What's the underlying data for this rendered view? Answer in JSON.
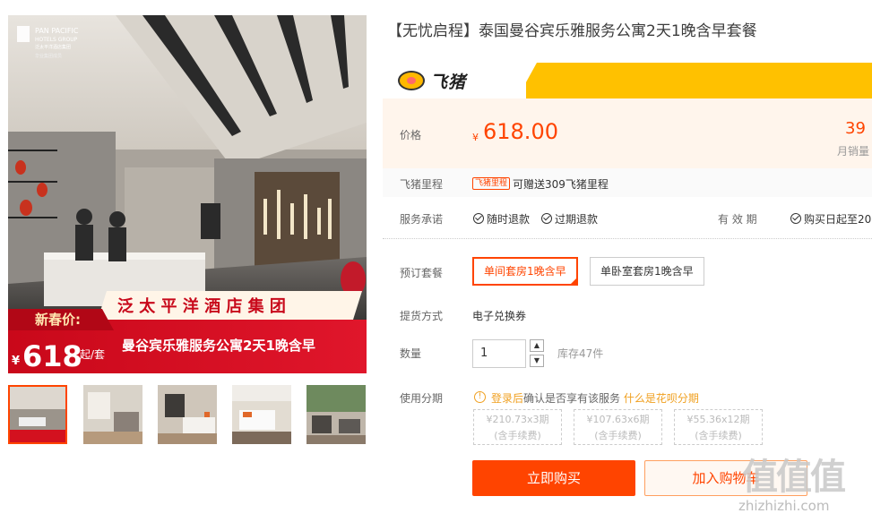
{
  "gallery": {
    "brand_line1": "PAN PACIFIC",
    "brand_line2": "HOTELS GROUP",
    "brand_cn": "泛太平洋酒店集团",
    "brand_sub": "华业集团成员",
    "promo_label": "新春价:",
    "promo_group": "泛 太 平 洋 酒 店 集 团",
    "promo_currency": "¥",
    "promo_price": "618",
    "promo_unit": "起/套",
    "promo_desc": "曼谷宾乐雅服务公寓2天1晚含早",
    "thumb_count": 5
  },
  "product": {
    "title": "【无忧启程】泰国曼谷宾乐雅服务公寓2天1晚含早套餐"
  },
  "fliggy": {
    "logo_text": "飞猪"
  },
  "price": {
    "label": "价格",
    "currency": "¥",
    "value": "618.00",
    "sales_count": "39",
    "sales_label": "月销量"
  },
  "mileage": {
    "label": "飞猪里程",
    "tag": "飞猪里程",
    "text": "可赠送309飞猪里程"
  },
  "service": {
    "label": "服务承诺",
    "items": [
      "随时退款",
      "过期退款"
    ],
    "validity_label": "有 效 期",
    "validity_value": "购买日起至20"
  },
  "package": {
    "label": "预订套餐",
    "options": [
      "单间套房1晚含早",
      "单卧室套房1晚含早"
    ],
    "selected": 0
  },
  "delivery": {
    "label": "提货方式",
    "value": "电子兑换券"
  },
  "quantity": {
    "label": "数量",
    "value": "1",
    "up": "▲",
    "down": "▼",
    "stock": "库存47件"
  },
  "installment": {
    "label": "使用分期",
    "notice_link": "登录后",
    "notice_text": "确认是否享有该服务",
    "notice_help": "什么是花呗分期",
    "plans": [
      {
        "amount": "¥210.73",
        "periods": "x3期",
        "fee": "(含手续费)"
      },
      {
        "amount": "¥107.63",
        "periods": "x6期",
        "fee": "(含手续费)"
      },
      {
        "amount": "¥55.36",
        "periods": "x12期",
        "fee": "(含手续费)"
      }
    ]
  },
  "actions": {
    "buy": "立即购买",
    "cart": "加入购物车"
  },
  "watermark": {
    "big": "值值值",
    "small": "zhizhizhi.com"
  },
  "colors": {
    "accent": "#ff4400",
    "fliggy_yellow": "#ffc100",
    "price_bg": "#fff5ec",
    "notice": "#f0a020"
  }
}
